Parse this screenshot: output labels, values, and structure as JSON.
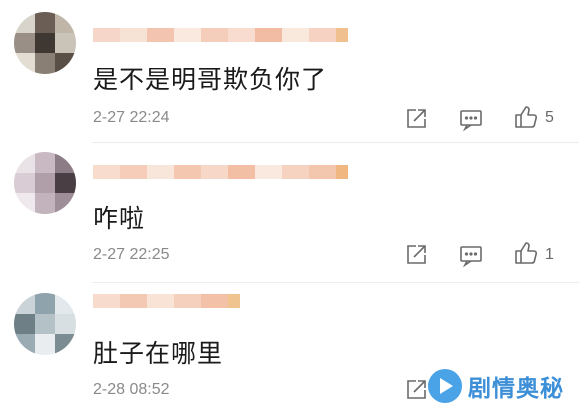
{
  "comments": [
    {
      "text": "是不是明哥欺负你了",
      "timestamp": "2-27 22:24",
      "like_count": "5",
      "avatar_colors": [
        "#d8d4cc",
        "#6b5e55",
        "#bfb6a8",
        "#9a8f86",
        "#3f3832",
        "#c9c3b8",
        "#e3ddd3",
        "#8a7f74",
        "#5a4f47"
      ],
      "name_blur_colors": [
        "#f6d6c8",
        "#f7e2d6",
        "#f3c5b1",
        "#f9e9df",
        "#f4cdbb",
        "#f8dccf",
        "#f2bca4",
        "#f9e8dc",
        "#f5d2c2",
        "#f0c08f"
      ]
    },
    {
      "text": "咋啦",
      "timestamp": "2-27 22:25",
      "like_count": "1",
      "avatar_colors": [
        "#e9e2e6",
        "#c8b9c3",
        "#8c7c86",
        "#d9ccd4",
        "#b09ea9",
        "#4a3e45",
        "#efe8ec",
        "#c2b3bd",
        "#9e8e98"
      ],
      "name_blur_colors": [
        "#f8ddcf",
        "#f5cdb8",
        "#f9e6da",
        "#f4c8b0",
        "#f7d8c8",
        "#f2bfa5",
        "#f9e9df",
        "#f6d3c1",
        "#f3c7ad",
        "#f0b880"
      ]
    },
    {
      "text": "肚子在哪里",
      "timestamp": "2-28 08:52",
      "like_count": "",
      "avatar_colors": [
        "#c9d3d8",
        "#8fa3ad",
        "#e2e8eb",
        "#6f7f86",
        "#b4c2c8",
        "#d8dfe2",
        "#9aabb3",
        "#e9edef",
        "#7c8c93"
      ],
      "name_blur_colors": [
        "#f7dccd",
        "#f4c9b3",
        "#f8e3d6",
        "#f5d0bd",
        "#f2c1a7",
        "#f0c48e"
      ]
    }
  ],
  "icons": {
    "share": "share-icon",
    "reply": "comment-icon",
    "like": "thumbs-up-icon"
  },
  "watermark": {
    "text": "剧情奥秘"
  },
  "colors": {
    "text": "#1a1a1a",
    "meta": "#8a8a8a",
    "icon": "#6a6a6a",
    "watermark": "#3d8fd8"
  }
}
